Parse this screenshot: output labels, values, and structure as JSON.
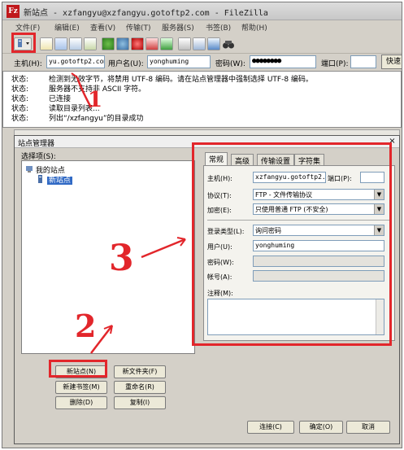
{
  "window": {
    "title": "新站点 - xzfangyu@xzfangyu.gotoftp2.com - FileZilla",
    "app_icon": "Fz"
  },
  "menu": [
    "文件(F)",
    "编辑(E)",
    "查看(V)",
    "传输(T)",
    "服务器(S)",
    "书签(B)",
    "帮助(H)"
  ],
  "quickconnect": {
    "host_label": "主机(H):",
    "host_value": "yu.gotoftp2.com",
    "user_label": "用户名(U):",
    "user_value": "yonghuming",
    "pass_label": "密码(W):",
    "pass_value": "●●●●●●●●",
    "port_label": "端口(P):",
    "port_value": "",
    "button": "快速"
  },
  "log": [
    {
      "k": "状态:",
      "v": "检测到无效字节，将禁用 UTF-8 编码。请在站点管理器中强制选择 UTF-8 编码。"
    },
    {
      "k": "状态:",
      "v": "服务器不支持非 ASCII 字符。"
    },
    {
      "k": "状态:",
      "v": "已连接"
    },
    {
      "k": "状态:",
      "v": "读取目录列表..."
    },
    {
      "k": "状态:",
      "v": "列出“/xzfangyu”的目录成功"
    }
  ],
  "dialog": {
    "title": "站点管理器",
    "close": "×",
    "select_site_label": "选择项(S):",
    "tree": {
      "root": "我的站点",
      "child": "新站点"
    },
    "buttons": {
      "new_site": "新站点(N)",
      "new_folder": "新文件夹(F)",
      "new_bookmark": "新建书签(M)",
      "rename": "重命名(R)",
      "delete": "删除(D)",
      "copy": "复制(I)",
      "connect": "连接(C)",
      "ok": "确定(O)",
      "cancel": "取消"
    },
    "tabs": [
      "常规",
      "高级",
      "传输设置",
      "字符集"
    ],
    "general": {
      "host_label": "主机(H):",
      "host_value": "xzfangyu.gotoftp2.c",
      "port_label": "端口(P):",
      "port_value": "",
      "protocol_label": "协议(T):",
      "protocol_value": "FTP - 文件传输协议",
      "encryption_label": "加密(E):",
      "encryption_value": "只使用普通 FTP (不安全)",
      "logon_label": "登录类型(L):",
      "logon_value": "询问密码",
      "user_label": "用户(U):",
      "user_value": "yonghuming",
      "password_label": "密码(W):",
      "account_label": "帐号(A):",
      "comments_label": "注释(M):"
    }
  },
  "annotations": {
    "one": "1",
    "two": "2",
    "three": "3"
  },
  "colors": {
    "annotation_red": "#e2262b",
    "chrome": "#d4d0c8"
  }
}
